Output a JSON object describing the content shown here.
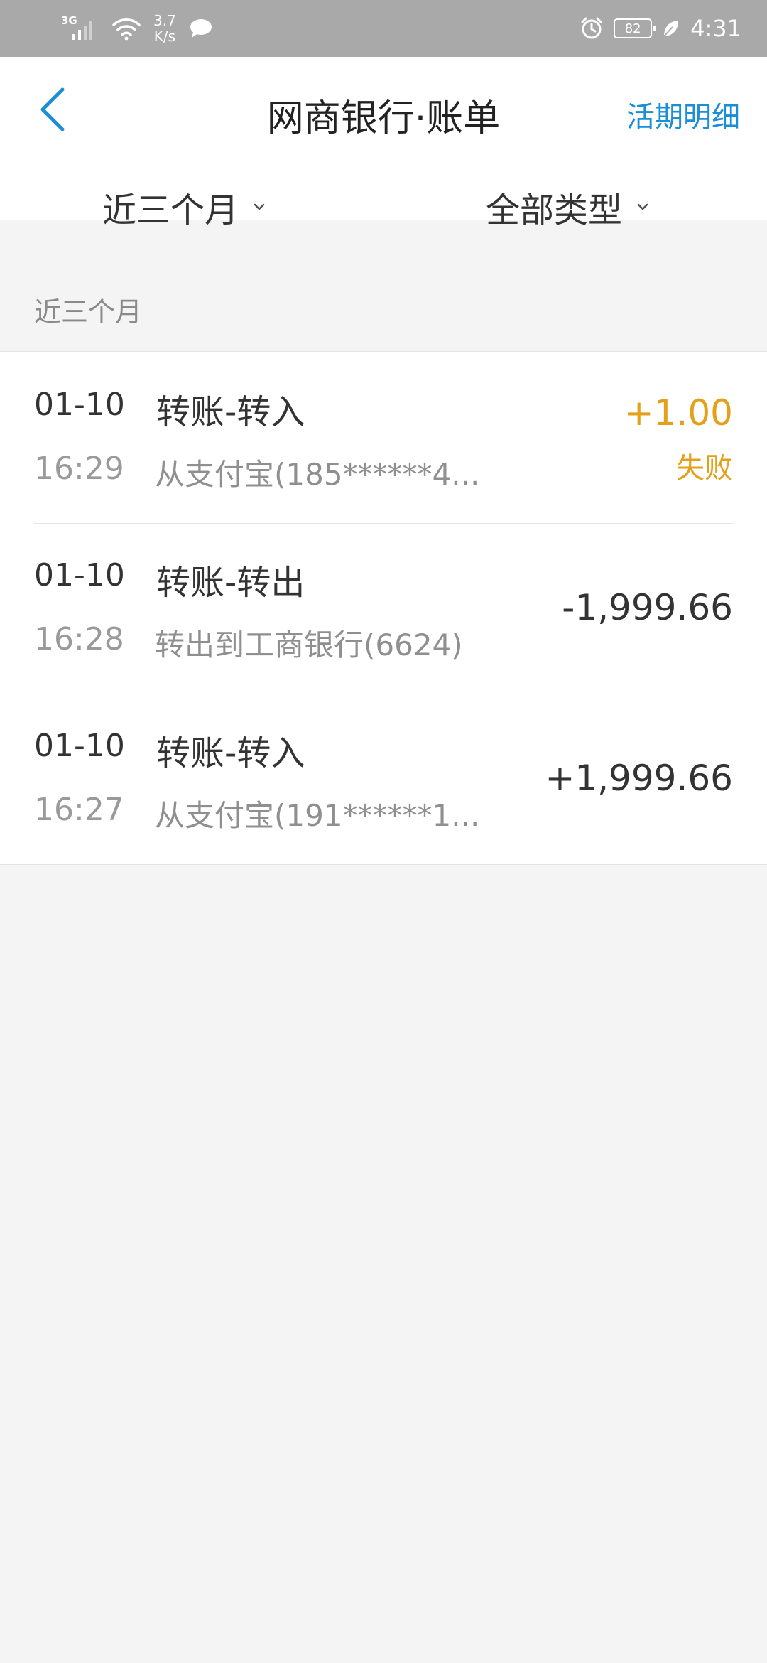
{
  "status_bar": {
    "network": "3G",
    "speed_value": "3.7",
    "speed_unit": "K/s",
    "battery": "82",
    "time": "4:31"
  },
  "header": {
    "title": "网商银行·账单",
    "detail_link": "活期明细"
  },
  "filters": {
    "period": "近三个月",
    "type": "全部类型"
  },
  "section": {
    "title": "近三个月"
  },
  "transactions": [
    {
      "date": "01-10",
      "time": "16:29",
      "type": "转账-转入",
      "description": "从支付宝(185******4...",
      "amount": "+1.00",
      "status": "失败"
    },
    {
      "date": "01-10",
      "time": "16:28",
      "type": "转账-转出",
      "description": "转出到工商银行(6624)",
      "amount": "-1,999.66"
    },
    {
      "date": "01-10",
      "time": "16:27",
      "type": "转账-转入",
      "description": "从支付宝(191******1...",
      "amount": "+1,999.66"
    }
  ],
  "colors": {
    "accent": "#1a8ed6",
    "warning": "#e3a018",
    "status_bar": "#a9a9a9",
    "background": "#f4f4f4"
  }
}
